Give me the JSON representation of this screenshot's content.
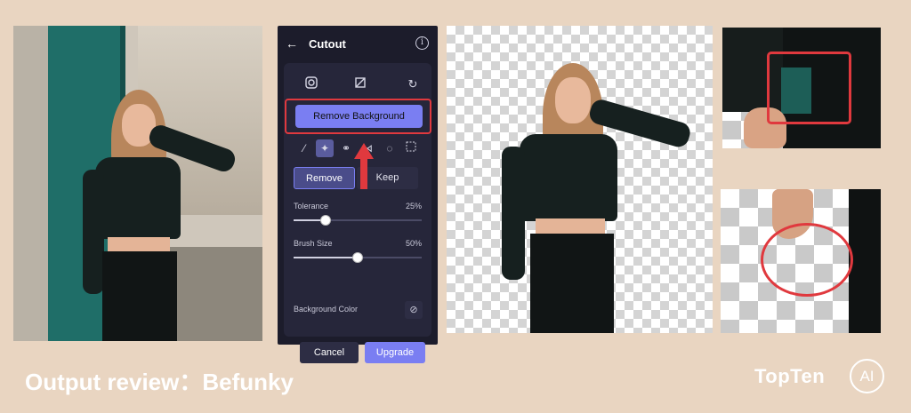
{
  "panel": {
    "title": "Cutout",
    "remove_background_label": "Remove Background",
    "mode_remove_label": "Remove",
    "mode_keep_label": "Keep",
    "tolerance_label": "Tolerance",
    "tolerance_value": "25%",
    "tolerance_level": 0.25,
    "brush_size_label": "Brush Size",
    "brush_size_value": "50%",
    "brush_size_level": 0.5,
    "background_color_label": "Background Color",
    "cancel_label": "Cancel",
    "upgrade_label": "Upgrade"
  },
  "tools": [
    "brush-icon",
    "magic-wand-icon",
    "lasso-icon",
    "polygon-lasso-icon",
    "ellipse-select-icon",
    "rect-select-icon"
  ],
  "top_icons": [
    "instagram-icon",
    "crop-icon",
    "refresh-icon"
  ],
  "caption": "Output review：Befunky",
  "logo": {
    "text": "TopTen",
    "badge": "AI"
  },
  "colors": {
    "accent": "#7a7ef2",
    "highlight": "#e0393e",
    "background": "#e9d5c1",
    "panel": "#1c1c2b"
  }
}
